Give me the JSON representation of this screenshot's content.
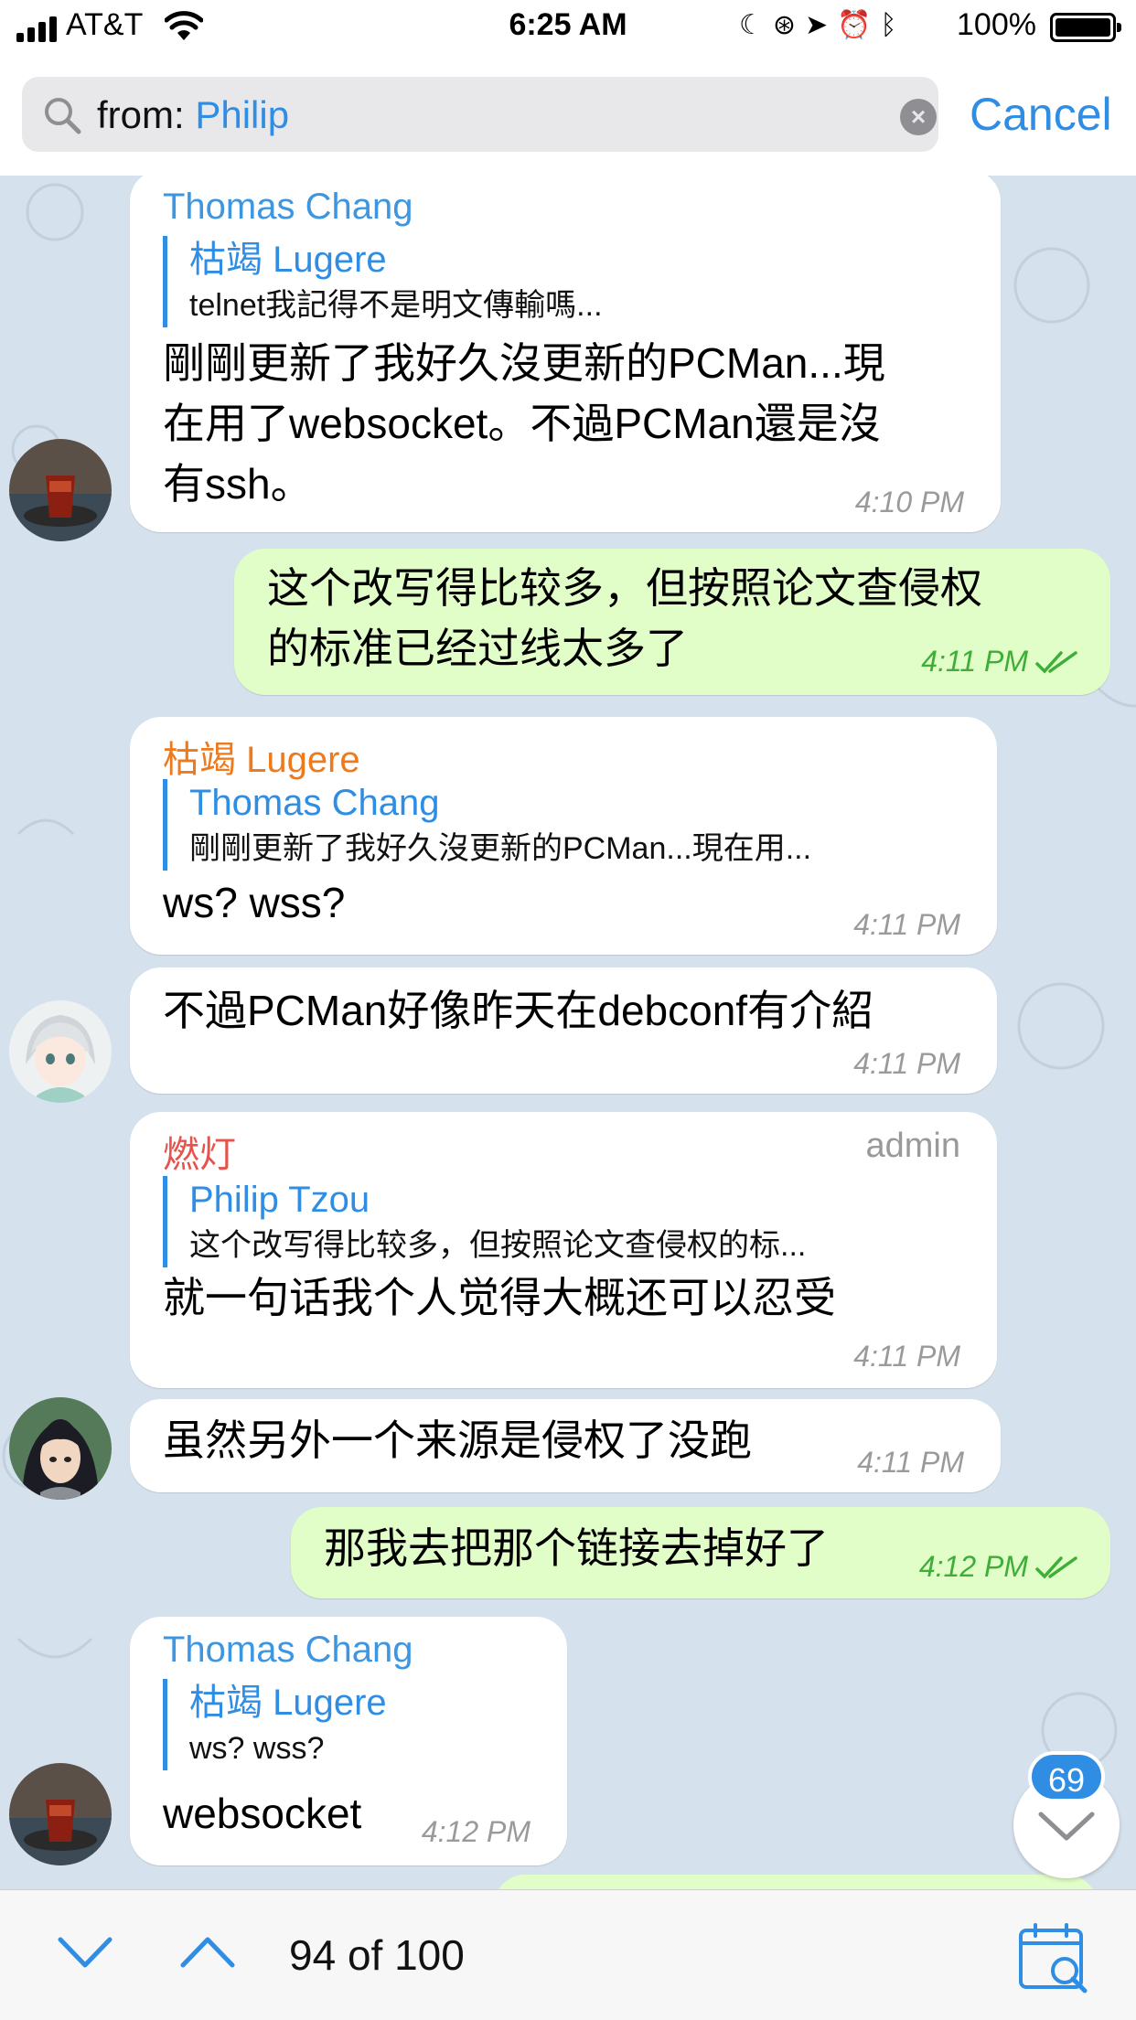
{
  "status_bar": {
    "carrier": "AT&T",
    "time": "6:25 AM",
    "battery": "100%"
  },
  "search": {
    "prefix": "from: ",
    "token": "Philip",
    "cancel_label": "Cancel"
  },
  "messages": [
    {
      "sender": "Thomas Chang",
      "sender_color": "#3e95e0",
      "reply_name": "枯竭 Lugere",
      "reply_text": "telnet我記得不是明文傳輸嗎...",
      "text_lines": [
        "剛剛更新了我好久沒更新的PCMan...現",
        "在用了websocket。不過PCMan還是沒",
        "有ssh。"
      ],
      "time": "4:10 PM"
    },
    {
      "outgoing": true,
      "text_lines": [
        "这个改写得比较多，但按照论文查侵权",
        "的标准已经过线太多了"
      ],
      "time": "4:11 PM"
    },
    {
      "sender": "枯竭 Lugere",
      "sender_color": "#ee7a1e",
      "reply_name": "Thomas Chang",
      "reply_text": "剛剛更新了我好久沒更新的PCMan...現在用...",
      "text_lines": [
        "ws? wss?"
      ],
      "time": "4:11 PM"
    },
    {
      "text_lines": [
        "不過PCMan好像昨天在debconf有介紹"
      ],
      "time": "4:11 PM"
    },
    {
      "sender": "燃灯",
      "sender_color": "#e5534b",
      "role": "admin",
      "reply_name": "Philip Tzou",
      "reply_text": "这个改写得比较多，但按照论文查侵权的标...",
      "text_lines": [
        "就一句话我个人觉得大概还可以忍受"
      ],
      "time": "4:11 PM"
    },
    {
      "text_lines": [
        "虽然另外一个来源是侵权了没跑"
      ],
      "time": "4:11 PM"
    },
    {
      "outgoing": true,
      "text_lines": [
        "那我去把那个链接去掉好了"
      ],
      "time": "4:12 PM"
    },
    {
      "sender": "Thomas Chang",
      "sender_color": "#3e95e0",
      "reply_name": "枯竭 Lugere",
      "reply_text": "ws? wss?",
      "text_lines": [
        "websocket"
      ],
      "time": "4:12 PM"
    }
  ],
  "unread_count": "69",
  "bottom_bar": {
    "result_count": "94 of 100"
  },
  "colors": {
    "accent": "#2f8de4",
    "outgoing_bubble": "#e1fdc8",
    "outgoing_time": "#3eae38",
    "chat_background": "#d5e1ec"
  }
}
